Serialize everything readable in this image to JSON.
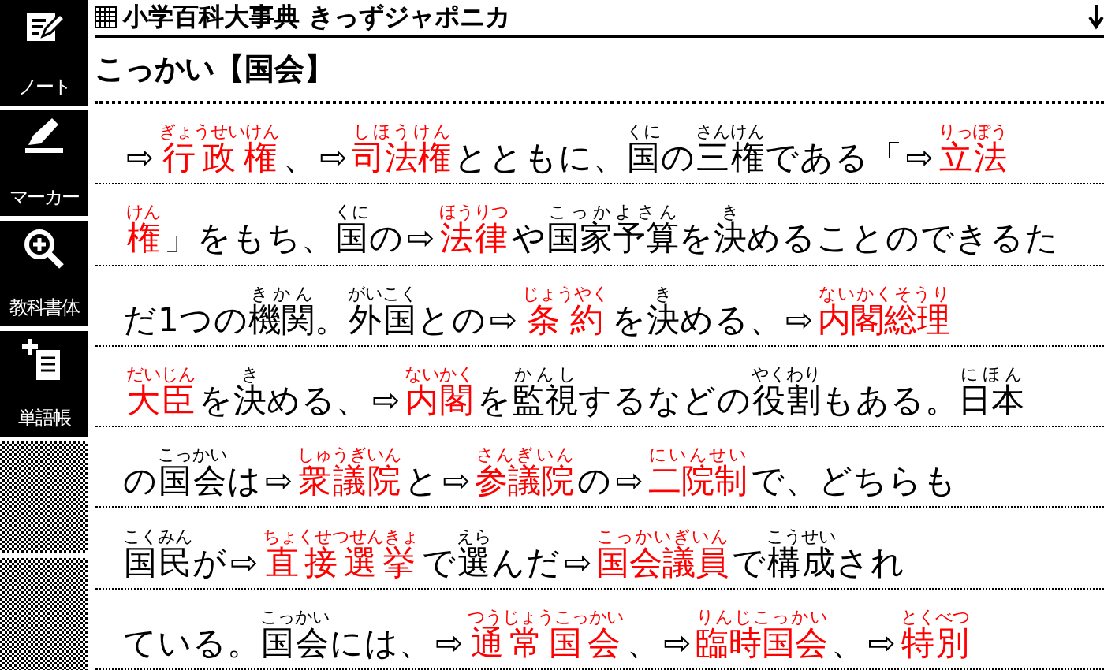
{
  "sidebar": {
    "buttons": [
      {
        "kind": "note",
        "label": "ノート"
      },
      {
        "kind": "marker",
        "label": "マーカー"
      },
      {
        "kind": "font",
        "label": "教科書体"
      },
      {
        "kind": "wordbook",
        "label": "単語帳"
      }
    ]
  },
  "header": {
    "title": "小学百科大事典 きっずジャポニカ"
  },
  "entry": {
    "heading": "こっかい【国会】",
    "lines": [
      [
        {
          "kind": "link",
          "arrow": "⇨",
          "text": "行政権",
          "ruby": "ぎょうせいけん"
        },
        {
          "kind": "plain",
          "text": "、"
        },
        {
          "kind": "link",
          "arrow": "⇨",
          "text": "司法権",
          "ruby": "しほうけん"
        },
        {
          "kind": "plain",
          "text": "とともに、"
        },
        {
          "kind": "plain",
          "text": "国",
          "ruby": "くに"
        },
        {
          "kind": "plain",
          "text": "の"
        },
        {
          "kind": "plain",
          "text": "三権",
          "ruby": "さんけん"
        },
        {
          "kind": "plain",
          "text": "である「"
        },
        {
          "kind": "link",
          "arrow": "⇨",
          "text": "立法",
          "ruby": "りっぽう"
        }
      ],
      [
        {
          "kind": "link",
          "text": "権",
          "ruby": "けん"
        },
        {
          "kind": "plain",
          "text": "」をもち、"
        },
        {
          "kind": "plain",
          "text": "国",
          "ruby": "くに"
        },
        {
          "kind": "plain",
          "text": "の"
        },
        {
          "kind": "link",
          "arrow": "⇨",
          "text": "法律",
          "ruby": "ほうりつ"
        },
        {
          "kind": "plain",
          "text": "や"
        },
        {
          "kind": "plain",
          "text": "国家予算",
          "ruby": "こっかよさん"
        },
        {
          "kind": "plain",
          "text": "を"
        },
        {
          "kind": "plain",
          "text": "決",
          "ruby": "き"
        },
        {
          "kind": "plain",
          "text": "めることのできるた"
        }
      ],
      [
        {
          "kind": "plain",
          "text": "だ1つの"
        },
        {
          "kind": "plain",
          "text": "機関",
          "ruby": "きかん"
        },
        {
          "kind": "plain",
          "text": "。"
        },
        {
          "kind": "plain",
          "text": "外国",
          "ruby": "がいこく"
        },
        {
          "kind": "plain",
          "text": "との"
        },
        {
          "kind": "link",
          "arrow": "⇨",
          "text": "条約",
          "ruby": "じょうやく"
        },
        {
          "kind": "plain",
          "text": "を"
        },
        {
          "kind": "plain",
          "text": "決",
          "ruby": "き"
        },
        {
          "kind": "plain",
          "text": "める、"
        },
        {
          "kind": "link",
          "arrow": "⇨",
          "text": "内閣総理",
          "ruby": "ないかくそうり"
        }
      ],
      [
        {
          "kind": "link",
          "text": "大臣",
          "ruby": "だいじん"
        },
        {
          "kind": "plain",
          "text": "を"
        },
        {
          "kind": "plain",
          "text": "決",
          "ruby": "き"
        },
        {
          "kind": "plain",
          "text": "める、"
        },
        {
          "kind": "link",
          "arrow": "⇨",
          "text": "内閣",
          "ruby": "ないかく"
        },
        {
          "kind": "plain",
          "text": "を"
        },
        {
          "kind": "plain",
          "text": "監視",
          "ruby": "かんし"
        },
        {
          "kind": "plain",
          "text": "するなどの"
        },
        {
          "kind": "plain",
          "text": "役割",
          "ruby": "やくわり"
        },
        {
          "kind": "plain",
          "text": "もある。"
        },
        {
          "kind": "plain",
          "text": "日本",
          "ruby": "にほん"
        }
      ],
      [
        {
          "kind": "plain",
          "text": "の"
        },
        {
          "kind": "plain",
          "text": "国会",
          "ruby": "こっかい"
        },
        {
          "kind": "plain",
          "text": "は"
        },
        {
          "kind": "link",
          "arrow": "⇨",
          "text": "衆議院",
          "ruby": "しゅうぎいん"
        },
        {
          "kind": "plain",
          "text": "と"
        },
        {
          "kind": "link",
          "arrow": "⇨",
          "text": "参議院",
          "ruby": "さんぎいん"
        },
        {
          "kind": "plain",
          "text": "の"
        },
        {
          "kind": "link",
          "arrow": "⇨",
          "text": "二院制",
          "ruby": "にいんせい"
        },
        {
          "kind": "plain",
          "text": "で、どちらも"
        }
      ],
      [
        {
          "kind": "plain",
          "text": "国民",
          "ruby": "こくみん"
        },
        {
          "kind": "plain",
          "text": "が"
        },
        {
          "kind": "link",
          "arrow": "⇨",
          "text": "直接選挙",
          "ruby": "ちょくせつせんきょ"
        },
        {
          "kind": "plain",
          "text": "で"
        },
        {
          "kind": "plain",
          "text": "選",
          "ruby": "えら"
        },
        {
          "kind": "plain",
          "text": "んだ"
        },
        {
          "kind": "link",
          "arrow": "⇨",
          "text": "国会議員",
          "ruby": "こっかいぎいん"
        },
        {
          "kind": "plain",
          "text": "で"
        },
        {
          "kind": "plain",
          "text": "構成",
          "ruby": "こうせい"
        },
        {
          "kind": "plain",
          "text": "され"
        }
      ],
      [
        {
          "kind": "plain",
          "text": "ている。"
        },
        {
          "kind": "plain",
          "text": "国会",
          "ruby": "こっかい"
        },
        {
          "kind": "plain",
          "text": "には、"
        },
        {
          "kind": "link",
          "arrow": "⇨",
          "text": "通常国会",
          "ruby": "つうじょうこっかい"
        },
        {
          "kind": "plain",
          "text": "、"
        },
        {
          "kind": "link",
          "arrow": "⇨",
          "text": "臨時国会",
          "ruby": "りんじこっかい"
        },
        {
          "kind": "plain",
          "text": "、"
        },
        {
          "kind": "link",
          "arrow": "⇨",
          "text": "特別",
          "ruby": "とくべつ"
        }
      ]
    ]
  }
}
